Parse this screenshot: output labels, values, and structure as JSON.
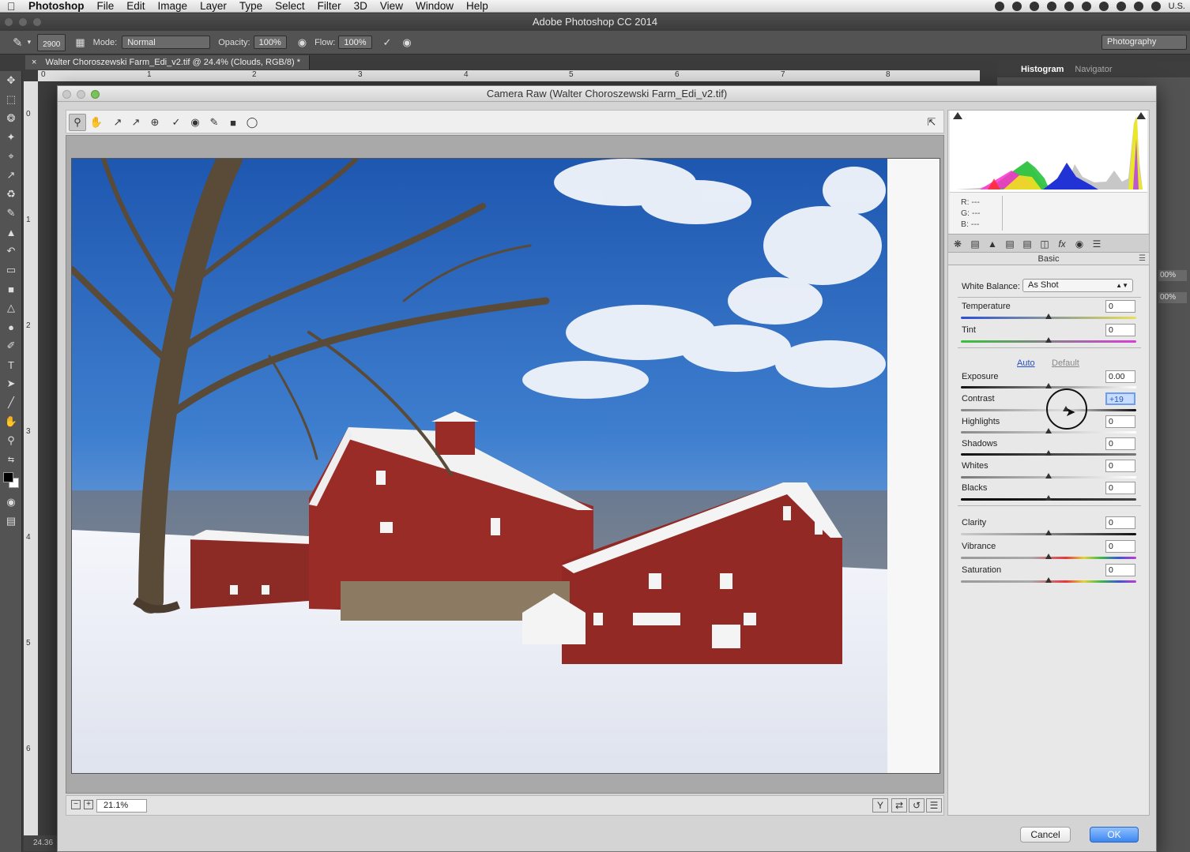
{
  "menubar": {
    "app": "Photoshop",
    "items": [
      "File",
      "Edit",
      "Image",
      "Layer",
      "Type",
      "Select",
      "Filter",
      "3D",
      "View",
      "Window",
      "Help"
    ],
    "locale": "U.S."
  },
  "app_title": "Adobe Photoshop CC 2014",
  "options_bar": {
    "brush_size": "2900",
    "mode_label": "Mode:",
    "mode_value": "Normal",
    "opacity_label": "Opacity:",
    "opacity_value": "100%",
    "flow_label": "Flow:",
    "flow_value": "100%",
    "workspace": "Photography"
  },
  "document_tab": "Walter Choroszewski Farm_Edi_v2.tif @ 24.4% (Clouds, RGB/8) *",
  "ruler": {
    "h": [
      "0",
      "1",
      "2",
      "3",
      "4",
      "5",
      "6",
      "7",
      "8"
    ],
    "v": [
      "0",
      "1",
      "2",
      "3",
      "4",
      "5",
      "6"
    ]
  },
  "panel_tabs": {
    "histogram": "Histogram",
    "navigator": "Navigator"
  },
  "status_zoom": "24.36",
  "panel_side_values": [
    "00%",
    "00%"
  ],
  "camera_raw": {
    "title": "Camera Raw (Walter Choroszewski Farm_Edi_v2.tif)",
    "zoom": "21.1%",
    "rgb_readout": {
      "r": "R:",
      "r_val": "---",
      "g": "G:",
      "g_val": "---",
      "b": "B:",
      "b_val": "---"
    },
    "panel_name": "Basic",
    "white_balance_label": "White Balance:",
    "white_balance_value": "As Shot",
    "auto": "Auto",
    "default": "Default",
    "sliders": {
      "temperature": {
        "label": "Temperature",
        "value": "0"
      },
      "tint": {
        "label": "Tint",
        "value": "0"
      },
      "exposure": {
        "label": "Exposure",
        "value": "0.00"
      },
      "contrast": {
        "label": "Contrast",
        "value": "+19"
      },
      "highlights": {
        "label": "Highlights",
        "value": "0"
      },
      "shadows": {
        "label": "Shadows",
        "value": "0"
      },
      "whites": {
        "label": "Whites",
        "value": "0"
      },
      "blacks": {
        "label": "Blacks",
        "value": "0"
      },
      "clarity": {
        "label": "Clarity",
        "value": "0"
      },
      "vibrance": {
        "label": "Vibrance",
        "value": "0"
      },
      "saturation": {
        "label": "Saturation",
        "value": "0"
      }
    },
    "cancel": "Cancel",
    "ok": "OK"
  }
}
